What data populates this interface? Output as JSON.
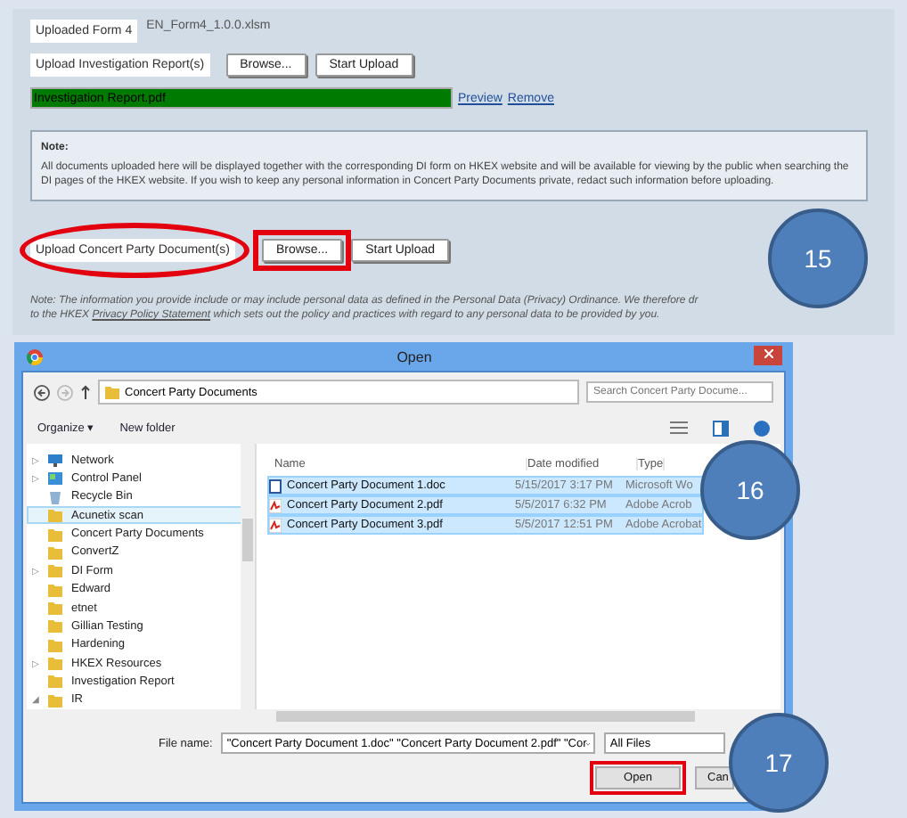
{
  "form": {
    "uploaded_form": {
      "label": "Uploaded Form 4",
      "file": "EN_Form4_1.0.0.xlsm"
    },
    "investigation_upload": {
      "label": "Upload Investigation Report(s)",
      "browse": "Browse...",
      "start": "Start Upload",
      "file": {
        "name": "Investigation Report.pdf",
        "level": 1
      },
      "links": [
        "Preview",
        "Remove"
      ]
    },
    "note": {
      "title": "Note:",
      "text": "All documents uploaded here will be displayed together with the corresponding DI form on HKEX website and will be available for viewing by the public when searching the DI pages of the HKEX website. If you wish to keep any personal information in Concert Party Documents private, redact such information before uploading."
    },
    "concert_upload": {
      "label": "Upload Concert Party Document(s)",
      "label_circled": true,
      "browse": "Browse...",
      "browse_highlighted": true,
      "start": "Start Upload"
    },
    "privacy_note": {
      "line1": "Note: The information you provide include or may include personal data as defined in the Personal Data (Privacy) Ordinance. We therefore dr",
      "line2_before": "to the HKEX ",
      "link": "Privacy Policy Statement",
      "line2_after": " which sets out the policy and practices with regard to any personal data to be provided by you."
    }
  },
  "dialog": {
    "title": "Open",
    "path": "Concert Party Documents",
    "search": {
      "placeholder": "Search Concert Party Docume..."
    },
    "toolbar": [
      "Organize ▾",
      "New folder"
    ],
    "nav": [
      {
        "label": "Network",
        "kind": "network",
        "toggle": "▷",
        "selected": false
      },
      {
        "label": "Control Panel",
        "kind": "panel",
        "toggle": "▷",
        "selected": false
      },
      {
        "label": "Recycle Bin",
        "kind": "bin",
        "selected": false
      },
      {
        "label": "Acunetix scan",
        "kind": "folder",
        "selected": true
      },
      {
        "label": "Concert Party Documents",
        "kind": "folder",
        "selected": false
      },
      {
        "label": "ConvertZ",
        "kind": "folder",
        "selected": false
      },
      {
        "label": "DI Form",
        "kind": "folder",
        "toggle": "▷",
        "selected": false
      },
      {
        "label": "Edward",
        "kind": "folder",
        "selected": false
      },
      {
        "label": "etnet",
        "kind": "folder",
        "selected": false
      },
      {
        "label": "Gillian Testing",
        "kind": "folder",
        "selected": false
      },
      {
        "label": "Hardening",
        "kind": "folder",
        "selected": false
      },
      {
        "label": "HKEX Resources",
        "kind": "folder",
        "toggle": "▷",
        "selected": false
      },
      {
        "label": "Investigation Report",
        "kind": "folder",
        "selected": false
      },
      {
        "label": "IR",
        "kind": "folder",
        "toggle": "◢",
        "selected": false
      }
    ],
    "columns": [
      "Name",
      "Date modified",
      "Type"
    ],
    "files": [
      {
        "name": "Concert Party Document 1.doc",
        "date": "5/15/2017 3:17 PM",
        "type": "Microsoft Wo",
        "kind": "word",
        "selected": true
      },
      {
        "name": "Concert Party Document 2.pdf",
        "date": "5/5/2017 6:32 PM",
        "type": "Adobe Acrob",
        "kind": "pdf",
        "selected": true
      },
      {
        "name": "Concert Party Document 3.pdf",
        "date": "5/5/2017 12:51 PM",
        "type": "Adobe Acrobat",
        "kind": "pdf",
        "selected": true
      }
    ],
    "file_name_label": "File name:",
    "file_name": "\"Concert Party Document 1.doc\" \"Concert Party Document 2.pdf\" \"Cor",
    "filter": "All Files",
    "open": "Open",
    "open_highlighted": true,
    "cancel": "Can"
  },
  "callouts": [
    {
      "number": "15"
    },
    {
      "number": "16"
    },
    {
      "number": "17"
    }
  ]
}
